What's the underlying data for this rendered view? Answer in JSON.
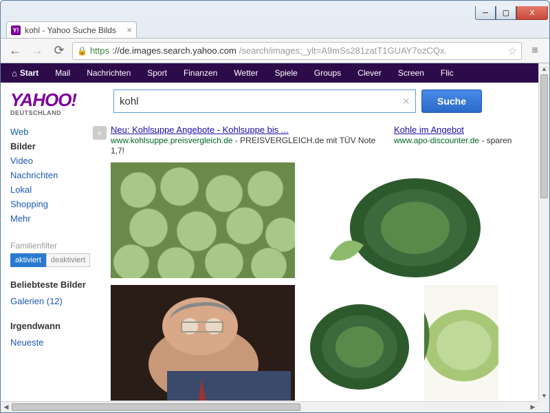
{
  "window": {
    "min": "_",
    "max": "□",
    "close": "X"
  },
  "tab": {
    "title": "kohl - Yahoo Suche Bilds",
    "favicon": "Y!",
    "close": "×"
  },
  "nav": {
    "back": "←",
    "forward": "→",
    "reload": "⟳",
    "menu": "≡"
  },
  "url": {
    "lock": "🔒",
    "https": "https",
    "host": "://de.images.search.yahoo.com",
    "path": "/search/images;_ylt=A9mSs281zatT1GUAY7ozCQx.",
    "star": "☆"
  },
  "ynav": [
    "Start",
    "Mail",
    "Nachrichten",
    "Sport",
    "Finanzen",
    "Wetter",
    "Spiele",
    "Groups",
    "Clever",
    "Screen",
    "Flic"
  ],
  "logo": {
    "main": "YAHOO",
    "bang": "!",
    "sub": "DEUTSCHLAND"
  },
  "search": {
    "value": "kohl",
    "clear": "×",
    "button": "Suche"
  },
  "sidebar": {
    "cats": [
      "Web",
      "Bilder",
      "Video",
      "Nachrichten",
      "Lokal",
      "Shopping",
      "Mehr"
    ],
    "active": 1,
    "filter_label": "Familienfilter",
    "on": "aktiviert",
    "off": "deaktiviert",
    "popular_h": "Beliebteste Bilder",
    "popular_link": "Galerien (12)",
    "anytime_h": "Irgendwann",
    "anytime_link": "Neueste"
  },
  "collapse": "«",
  "ads": [
    {
      "title": "Neu: Kohlsuppe Angebote - Kohlsuppe bis ...",
      "url": "www.kohlsuppe.preisvergleich.de",
      "desc": " - PREISVERGLEICH.de mit TÜV Note 1,7!"
    },
    {
      "title": "Kohle im Angebot",
      "url": "www.apo-discounter.de",
      "desc": " - sparen"
    }
  ]
}
